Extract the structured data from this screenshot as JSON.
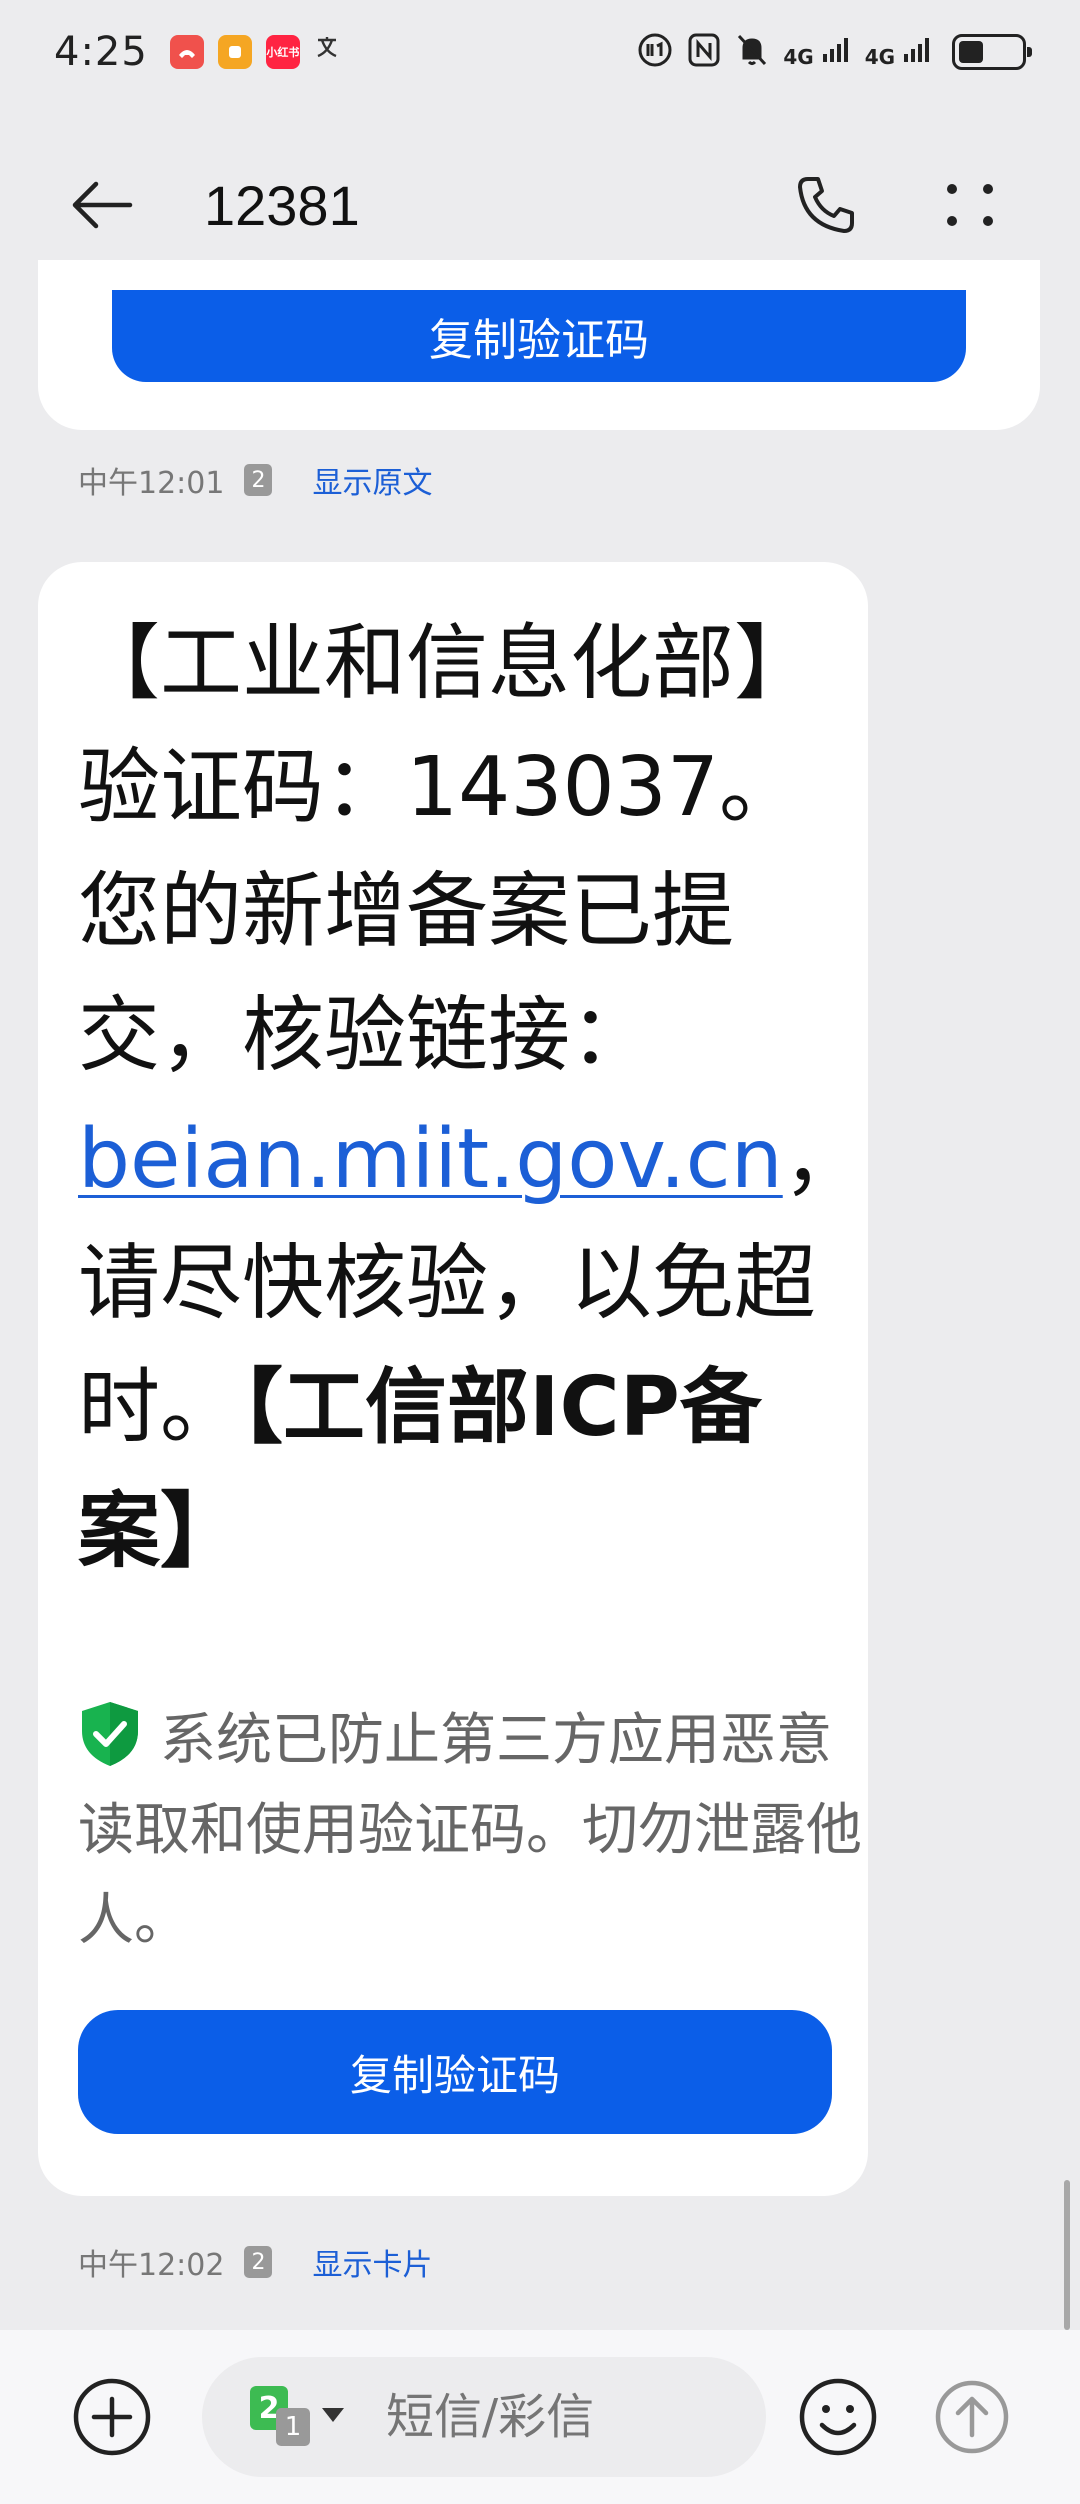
{
  "status_bar": {
    "time": "4:25",
    "notif_app_label": "小红书",
    "network_1": "4G",
    "network_2": "4G"
  },
  "header": {
    "title": "12381"
  },
  "previous_message": {
    "copy_button_label": "复制验证码",
    "time": "中午12:01",
    "sim_slot": "2",
    "action_link": "显示原文"
  },
  "message": {
    "body_part1": "【工业和信息化部】验证码：143037。您的新增备案已提交，核验链接：",
    "link_text": "beian.miit.gov.cn",
    "body_part2": "，请尽快核验，以免超时。",
    "body_bold": "【工信部ICP备案】",
    "security_note": "系统已防止第三方应用恶意读取和使用验证码。切勿泄露他人。",
    "copy_button_label": "复制验证码",
    "time": "中午12:02",
    "sim_slot": "2",
    "action_link": "显示卡片"
  },
  "input_bar": {
    "sim_primary": "2",
    "sim_secondary": "1",
    "placeholder": "短信/彩信"
  },
  "colors": {
    "accent": "#0b5ee8",
    "link": "#1c5fd6",
    "shield": "#18b34f"
  }
}
